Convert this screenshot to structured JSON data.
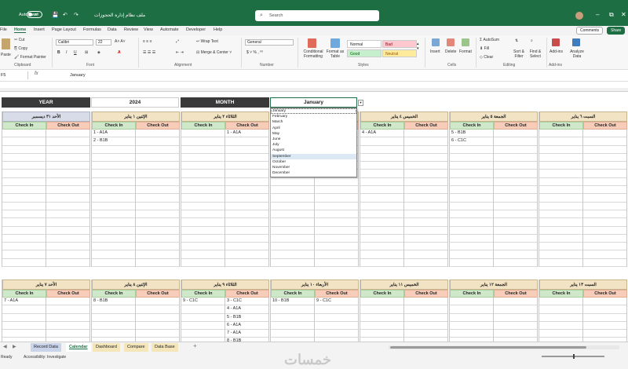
{
  "titlebar": {
    "autosave_label": "AutoSave",
    "autosave_state": "Off",
    "doc_title": "ملف نظام إدارة الحجوزات",
    "search_placeholder": "Search",
    "accent_color": "#1e6e44"
  },
  "ribbon_tabs": [
    "File",
    "Home",
    "Insert",
    "Page Layout",
    "Formulas",
    "Data",
    "Review",
    "View",
    "Automate",
    "Developer",
    "Help"
  ],
  "active_tab": "Home",
  "comments_label": "Comments",
  "share_label": "Share",
  "ribbon": {
    "clipboard": {
      "paste": "Paste",
      "cut": "Cut",
      "copy": "Copy",
      "format_painter": "Format Painter",
      "label": "Clipboard"
    },
    "font": {
      "family": "Calibri",
      "size": "22",
      "label": "Font"
    },
    "alignment": {
      "wrap": "Wrap Text",
      "merge": "Merge & Center",
      "label": "Alignment"
    },
    "number": {
      "format": "General",
      "label": "Number"
    },
    "styles": {
      "conditional": "Conditional Formatting",
      "format_table": "Format as Table",
      "cells": [
        {
          "name": "Normal",
          "bg": "#ffffff",
          "fg": "#222222"
        },
        {
          "name": "Bad",
          "bg": "#ffc7ce",
          "fg": "#9c0006"
        },
        {
          "name": "Good",
          "bg": "#c6efce",
          "fg": "#006100"
        },
        {
          "name": "Neutral",
          "bg": "#ffeb9c",
          "fg": "#9c5700"
        }
      ],
      "label": "Styles"
    },
    "cells": {
      "insert": "Insert",
      "delete": "Delete",
      "format": "Format",
      "label": "Cells"
    },
    "editing": {
      "autosum": "AutoSum",
      "fill": "Fill",
      "clear": "Clear",
      "sort": "Sort & Filter",
      "find": "Find & Select",
      "label": "Editing"
    },
    "addins": {
      "addins": "Add-ins",
      "analyze": "Analyze Data",
      "label": "Add-ins"
    }
  },
  "formula": {
    "namebox": "F5",
    "fx": "fx",
    "value": "January"
  },
  "header": {
    "year_label": "YEAR",
    "year_value": "2024",
    "month_label": "MONTH",
    "month_value": "January"
  },
  "months": [
    "January",
    "February",
    "March",
    "April",
    "May",
    "June",
    "July",
    "August",
    "September",
    "October",
    "November",
    "December"
  ],
  "check_in": "Check In",
  "check_out": "Check Out",
  "week1": [
    {
      "title": "الأحد ٣١ ديسمبر",
      "style": "gray",
      "ci": [],
      "co": []
    },
    {
      "title": "الإثنين ١ يناير",
      "style": "tan",
      "ci": [
        "1 - A1A",
        "2 - B1B"
      ],
      "co": []
    },
    {
      "title": "الثلاثاء ٢ يناير",
      "style": "tan",
      "ci": [],
      "co": [
        "1 - A1A"
      ]
    },
    {
      "title": "الأربعاء ٣ يناير",
      "style": "tan",
      "ci": [],
      "co": []
    },
    {
      "title": "الخميس ٤ يناير",
      "style": "tan",
      "ci": [
        "4 - A1A"
      ],
      "co": []
    },
    {
      "title": "الجمعة ٥ يناير",
      "style": "tan",
      "ci": [
        "5 - B1B",
        "6 - C1C"
      ],
      "co": []
    },
    {
      "title": "السبت ٦ يناير",
      "style": "tan",
      "ci": [],
      "co": []
    }
  ],
  "week2": [
    {
      "title": "الأحد ٧ يناير",
      "style": "tan",
      "ci": [
        "7 - A1A"
      ],
      "co": []
    },
    {
      "title": "الإثنين ٨ يناير",
      "style": "tan",
      "ci": [
        "8 - B1B"
      ],
      "co": []
    },
    {
      "title": "الثلاثاء ٩ يناير",
      "style": "tan",
      "ci": [
        "9 - C1C"
      ],
      "co": [
        "3 - C1C",
        "4 - A1A",
        "5 - B1B",
        "6 - A1A",
        "7 - A1A",
        "8 - B1B"
      ]
    },
    {
      "title": "الأربعاء ١٠ يناير",
      "style": "tan",
      "ci": [
        "10 - B1B"
      ],
      "co": [
        "9 - C1C"
      ]
    },
    {
      "title": "الخميس ١١ يناير",
      "style": "tan",
      "ci": [],
      "co": []
    },
    {
      "title": "الجمعة ١٢ يناير",
      "style": "tan",
      "ci": [],
      "co": []
    },
    {
      "title": "السبت ١٣ يناير",
      "style": "tan",
      "ci": [],
      "co": []
    }
  ],
  "sheet_tabs": [
    "Record Data",
    "Calendar",
    "Dashboard",
    "Compare",
    "Data Base"
  ],
  "active_sheet": "Calendar",
  "sheet_tab_colors": [
    "#c9d4ea",
    "#ffffff",
    "#f4e6b8",
    "#f4e6b8",
    "#f4e6b8"
  ],
  "status": {
    "ready": "Ready",
    "accessibility": "Accessibility: Investigate"
  },
  "watermark": "خمسات"
}
